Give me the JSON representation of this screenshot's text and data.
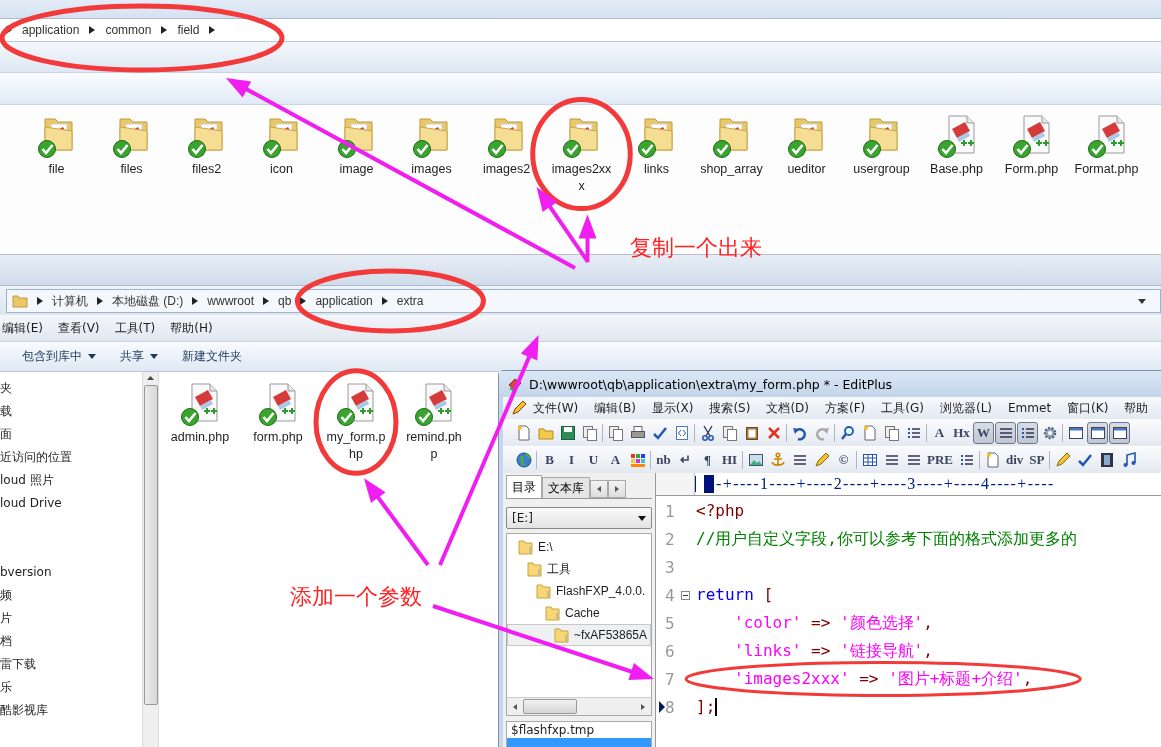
{
  "top_explorer": {
    "breadcrumb": [
      "application",
      "common",
      "field"
    ],
    "items": [
      {
        "name": "file",
        "kind": "folder"
      },
      {
        "name": "files",
        "kind": "folder"
      },
      {
        "name": "files2",
        "kind": "folder"
      },
      {
        "name": "icon",
        "kind": "folder"
      },
      {
        "name": "image",
        "kind": "folder"
      },
      {
        "name": "images",
        "kind": "folder"
      },
      {
        "name": "images2",
        "kind": "folder"
      },
      {
        "name": "images2xxx",
        "kind": "folder"
      },
      {
        "name": "links",
        "kind": "folder"
      },
      {
        "name": "shop_array",
        "kind": "folder"
      },
      {
        "name": "ueditor",
        "kind": "folder"
      },
      {
        "name": "usergroup",
        "kind": "folder"
      },
      {
        "name": "Base.php",
        "kind": "php"
      },
      {
        "name": "Form.php",
        "kind": "php"
      },
      {
        "name": "Format.php",
        "kind": "php"
      }
    ]
  },
  "explorer": {
    "address": [
      "计算机",
      "本地磁盘 (D:)",
      "wwwroot",
      "qb",
      "application",
      "extra"
    ],
    "menu": [
      "编辑(E)",
      "查看(V)",
      "工具(T)",
      "帮助(H)"
    ],
    "commands": [
      {
        "label": "包含到库中",
        "dropdown": true
      },
      {
        "label": "共享",
        "dropdown": true
      },
      {
        "label": "新建文件夹",
        "dropdown": false
      }
    ],
    "nav_groups": [
      [
        "夹",
        "载",
        "面",
        "近访问的位置",
        "loud 照片",
        "loud Drive"
      ],
      [
        "bversion",
        "频",
        "片",
        "档",
        "雷下载",
        "乐",
        "酷影视库"
      ]
    ],
    "files": [
      {
        "name": "admin.php",
        "kind": "php"
      },
      {
        "name": "form.php",
        "kind": "php"
      },
      {
        "name": "my_form.php",
        "kind": "php"
      },
      {
        "name": "remind.php",
        "kind": "php"
      }
    ]
  },
  "editplus": {
    "title": "D:\\wwwroot\\qb\\application\\extra\\my_form.php * - EditPlus",
    "menu": [
      "文件(W)",
      "编辑(B)",
      "显示(X)",
      "搜索(S)",
      "文档(D)",
      "方案(F)",
      "工具(G)",
      "浏览器(L)",
      "Emmet",
      "窗口(K)",
      "帮助"
    ],
    "toolbar1": [
      [
        {
          "kind": "icon",
          "pressed": false
        },
        {
          "kind": "icon",
          "pressed": false
        },
        {
          "kind": "icon",
          "pressed": false
        },
        {
          "kind": "icon",
          "pressed": false
        }
      ],
      [
        {
          "kind": "icon",
          "pressed": false
        },
        {
          "kind": "icon",
          "pressed": false
        },
        {
          "kind": "icon",
          "pressed": false
        },
        {
          "kind": "icon",
          "pressed": false
        }
      ],
      [
        {
          "kind": "icon",
          "pressed": false
        },
        {
          "kind": "icon",
          "pressed": false
        },
        {
          "kind": "icon",
          "pressed": false
        },
        {
          "kind": "icon",
          "pressed": false
        }
      ],
      [
        {
          "kind": "icon",
          "pressed": false
        },
        {
          "kind": "icon",
          "pressed": false
        }
      ],
      [
        {
          "kind": "icon",
          "pressed": false
        },
        {
          "kind": "icon",
          "pressed": false
        },
        {
          "kind": "icon",
          "pressed": false
        },
        {
          "kind": "icon",
          "pressed": false
        }
      ],
      [
        {
          "kind": "text",
          "label": "A",
          "pressed": false
        },
        {
          "kind": "text",
          "label": "Hx",
          "pressed": false
        },
        {
          "kind": "text",
          "label": "W",
          "pressed": true
        },
        {
          "kind": "icon",
          "pressed": true
        },
        {
          "kind": "icon",
          "pressed": true
        },
        {
          "kind": "icon",
          "pressed": false
        }
      ],
      [
        {
          "kind": "icon",
          "pressed": false
        },
        {
          "kind": "icon",
          "pressed": true
        },
        {
          "kind": "icon",
          "pressed": true
        }
      ]
    ],
    "toolbar2": [
      [
        {
          "kind": "icon",
          "pressed": false
        }
      ],
      [
        {
          "kind": "text",
          "label": "B",
          "pressed": false
        },
        {
          "kind": "text",
          "label": "I",
          "pressed": false
        },
        {
          "kind": "text",
          "label": "U",
          "pressed": false
        },
        {
          "kind": "text",
          "label": "A",
          "pressed": false
        },
        {
          "kind": "icon",
          "pressed": false
        }
      ],
      [
        {
          "kind": "text",
          "label": "nb",
          "pressed": false
        },
        {
          "kind": "text",
          "label": "↵",
          "pressed": false
        },
        {
          "kind": "text",
          "label": "¶",
          "pressed": false
        },
        {
          "kind": "text",
          "label": "HI",
          "pressed": false
        }
      ],
      [
        {
          "kind": "icon",
          "pressed": false
        },
        {
          "kind": "icon",
          "pressed": false
        },
        {
          "kind": "icon",
          "pressed": false
        },
        {
          "kind": "icon",
          "pressed": false
        },
        {
          "kind": "text",
          "label": "©",
          "pressed": false
        }
      ],
      [
        {
          "kind": "icon",
          "pressed": false
        },
        {
          "kind": "icon",
          "pressed": false
        },
        {
          "kind": "icon",
          "pressed": false
        },
        {
          "kind": "text",
          "label": "PRE",
          "pressed": false
        },
        {
          "kind": "icon",
          "pressed": false
        }
      ],
      [
        {
          "kind": "icon",
          "pressed": false
        },
        {
          "kind": "text",
          "label": "div",
          "pressed": false
        },
        {
          "kind": "text",
          "label": "SP",
          "pressed": false
        }
      ],
      [
        {
          "kind": "icon",
          "pressed": false
        },
        {
          "kind": "icon",
          "pressed": false
        },
        {
          "kind": "icon",
          "pressed": false
        },
        {
          "kind": "icon",
          "pressed": false
        }
      ]
    ],
    "panel_tabs": [
      {
        "label": "目录",
        "selected": true
      },
      {
        "label": "文本库",
        "selected": false
      }
    ],
    "drive": "[E:]",
    "tree": [
      {
        "label": "E:\\",
        "selected": false,
        "children": [
          {
            "label": "工具",
            "selected": false,
            "children": [
              {
                "label": "FlashFXP_4.0.0.",
                "selected": false,
                "children": [
                  {
                    "label": "Cache",
                    "selected": false,
                    "children": [
                      {
                        "label": "~fxAF53865A",
                        "selected": true
                      }
                    ]
                  }
                ]
              }
            ]
          }
        ]
      }
    ],
    "file_list": [
      "$flashfxp.tmp"
    ],
    "ruler": "-+----1----+----2----+----3----+----4----+----",
    "lines": [
      {
        "number": "1",
        "fold": false,
        "current": false,
        "indented": false,
        "segments": [
          {
            "text": "<?php",
            "kind": "tag"
          }
        ]
      },
      {
        "number": "2",
        "fold": false,
        "current": false,
        "indented": false,
        "segments": [
          {
            "text": "//用户自定义字段,你可以参考下面的格式添加更多的",
            "kind": "comment"
          }
        ]
      },
      {
        "number": "3",
        "fold": false,
        "current": false
      },
      {
        "number": "4",
        "fold": true,
        "current": false,
        "indented": false,
        "segments": [
          {
            "text": "return",
            "kind": "keyword"
          },
          {
            "text": " [",
            "kind": "punct"
          }
        ]
      },
      {
        "number": "5",
        "fold": false,
        "current": false,
        "indented": true,
        "segments": [
          {
            "text": "'color'",
            "kind": "string"
          },
          {
            "text": " => ",
            "kind": "punct"
          },
          {
            "text": "'颜色选择'",
            "kind": "string"
          },
          {
            "text": ",",
            "kind": "punct"
          }
        ]
      },
      {
        "number": "6",
        "fold": false,
        "current": false,
        "indented": true,
        "segments": [
          {
            "text": "'links'",
            "kind": "string"
          },
          {
            "text": " => ",
            "kind": "punct"
          },
          {
            "text": "'链接导航'",
            "kind": "string"
          },
          {
            "text": ",",
            "kind": "punct"
          }
        ]
      },
      {
        "number": "7",
        "fold": false,
        "current": false,
        "indented": true,
        "segments": [
          {
            "text": "'images2xxx'",
            "kind": "string"
          },
          {
            "text": " => ",
            "kind": "punct"
          },
          {
            "text": "'图片+标题+介绍'",
            "kind": "string"
          },
          {
            "text": ",",
            "kind": "punct"
          }
        ]
      },
      {
        "number": "8",
        "fold": false,
        "current": true,
        "indented": false,
        "segments": [
          {
            "text": "];",
            "kind": "punct"
          }
        ]
      }
    ]
  },
  "annotations": [
    {
      "text": "复制一个出来"
    },
    {
      "text": "添加一个参数"
    }
  ]
}
